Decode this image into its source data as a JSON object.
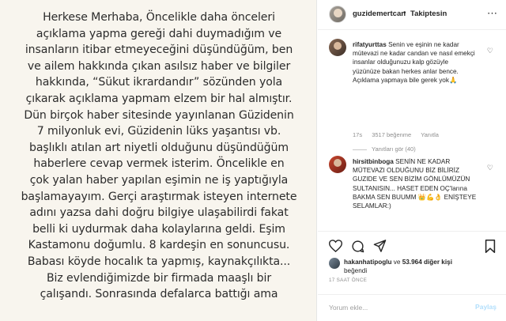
{
  "image_text": {
    "lines": [
      "Herkese Merhaba,  Öncelikle daha önceleri",
      "açıklama yapma gereği dahi duymadığım ve",
      "insanların itibar etmeyeceğini düşündüğüm, ben",
      "ve ailem hakkında çıkan asılsız haber ve bilgiler",
      "hakkında, “Sükut ikrardandır” sözünden yola",
      "çıkarak açıklama yapmam elzem bir hal almıştır.",
      "Dün birçok haber sitesinde yayınlanan Güzidenin",
      "7 milyonluk evi, Güzidenin lüks yaşantısı vb.",
      "başlıklı atılan art niyetli olduğunu düşündüğüm",
      "haberlere cevap vermek isterim.  Öncelikle en",
      "çok yalan haber yapılan eşimin ne iş yaptığıyla",
      "başlamayayım.  Gerçi araştırmak isteyen internete",
      "adını yazsa dahi doğru bilgiye ulaşabilirdi fakat",
      "belli ki uydurmak daha kolaylarına geldi. Eşim",
      "Kastamonu doğumlu. 8 kardeşin en sonuncusu.",
      "Babası köyde hocalık ta yapmış, kaynakçılıkta...",
      "Biz evlendiğimizde bir firmada maaşlı bir",
      "çalışandı.  Sonrasında  defalarca battığı ama"
    ]
  },
  "header": {
    "username": "guzidemertcan",
    "separator": "•",
    "follow_label": "Takiptesin",
    "more_icon": "⋯"
  },
  "comments": [
    {
      "username": "rifatyurttas",
      "text": "Senin ve eşinin ne kadar mütevazi ne kadar candan ve nasıl emekçi insanlar olduğunuzu kalp gözüyle yüzünüze bakan herkes anlar bence. Açıklama yapmaya bile gerek yok🙏",
      "time": "17s",
      "likes": "3517 beğenme",
      "reply_label": "Yanıtla",
      "view_replies": "Yanıtları gör (40)"
    },
    {
      "username": "hirsitbinboga",
      "text": "SENİN NE KADAR MÜTEVAZI OLDUĞUNU BİZ BİLİRİZ GUZIDE VE SEN BİZİM GÖNLÜMÜZÜN SULTANISIN... HASET EDEN OÇ'larına BAKMA SEN BUUMM 👑💪👌 ENİŞTEYE SELAMLAR:)"
    }
  ],
  "likes": {
    "user": "hakanhatipoglu",
    "connector": " ve ",
    "others": "53.964 diğer kişi",
    "suffix": "beğendi"
  },
  "timestamp": "17 SAAT ÖNCE",
  "comment_box": {
    "placeholder": "Yorum ekle...",
    "share_label": "Paylaş"
  },
  "icons": [
    "more-icon",
    "heart-icon",
    "comment-icon",
    "share-icon",
    "bookmark-icon"
  ],
  "colors": {
    "accent_light_blue": "#b2dffc",
    "secondary_text": "#8e8e8e",
    "image_bg": "#f8f5ee"
  }
}
